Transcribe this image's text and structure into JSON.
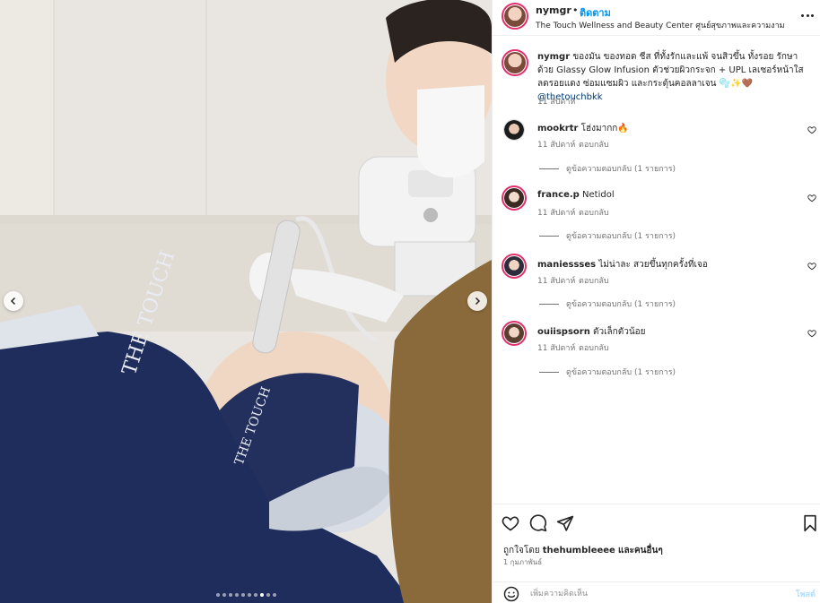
{
  "post": {
    "username": "nymgr",
    "separator": "•",
    "follow_label": "ติดตาม",
    "location": "The Touch Wellness and Beauty Center ศูนย์สุขภาพและความงาม",
    "caption_username": "nymgr",
    "caption_text": "ของมัน ของทอด ชีส ที่ทั้งรักและแพ้ จนสิวขึ้น ทั้งรอย รักษาด้วย Glassy Glow Infusion ตัวช่วยผิวกระจก + UPL เลเซอร์หน้าใส ลดรอยแดง ซ่อมแซมผิว และกระตุ้นคอลลาเจน 🫧✨🤎",
    "caption_mention": "@thetouchbkk",
    "caption_time": "11 สัปดาห์"
  },
  "photo": {
    "apron_brand": "THE TOUCH",
    "headband_brand": "THE TOUCH",
    "slide_count": 10,
    "active_slide": 8
  },
  "comments": [
    {
      "username": "mookrtr",
      "text": "โฮ่งมากก🔥",
      "time": "11 สัปดาห์",
      "reply_label": "ตอบกลับ",
      "view_replies": "ดูข้อความตอบกลับ (1 รายการ)"
    },
    {
      "username": "france.p",
      "text": "Netidol",
      "time": "11 สัปดาห์",
      "reply_label": "ตอบกลับ",
      "view_replies": "ดูข้อความตอบกลับ (1 รายการ)"
    },
    {
      "username": "maniessses",
      "text": "ไม่น่าละ สวยขึ้นทุกครั้งที่เจอ",
      "time": "11 สัปดาห์",
      "reply_label": "ตอบกลับ",
      "view_replies": "ดูข้อความตอบกลับ (1 รายการ)"
    },
    {
      "username": "ouiispsorn",
      "text": "ตัวเล็กตัวน้อย",
      "time": "11 สัปดาห์",
      "reply_label": "ตอบกลับ",
      "view_replies": "ดูข้อความตอบกลับ (1 รายการ)"
    }
  ],
  "footer": {
    "liked_by_prefix": "ถูกใจโดย",
    "liked_by_user": "thehumbleeee",
    "liked_by_suffix": "และคนอื่นๆ",
    "date": "1 กุมภาพันธ์",
    "comment_placeholder": "เพิ่มความคิดเห็น",
    "post_label": "โพสต์"
  },
  "icons": {
    "like": "heart-icon",
    "comment": "comment-icon",
    "share": "share-icon",
    "save": "bookmark-icon",
    "emoji": "emoji-icon",
    "more": "more-options-icon"
  },
  "colors": {
    "accent": "#0095f6",
    "story_ring": "#e1306c",
    "apron": "#1f2d5c",
    "staff_uniform": "#8a6a3a"
  }
}
